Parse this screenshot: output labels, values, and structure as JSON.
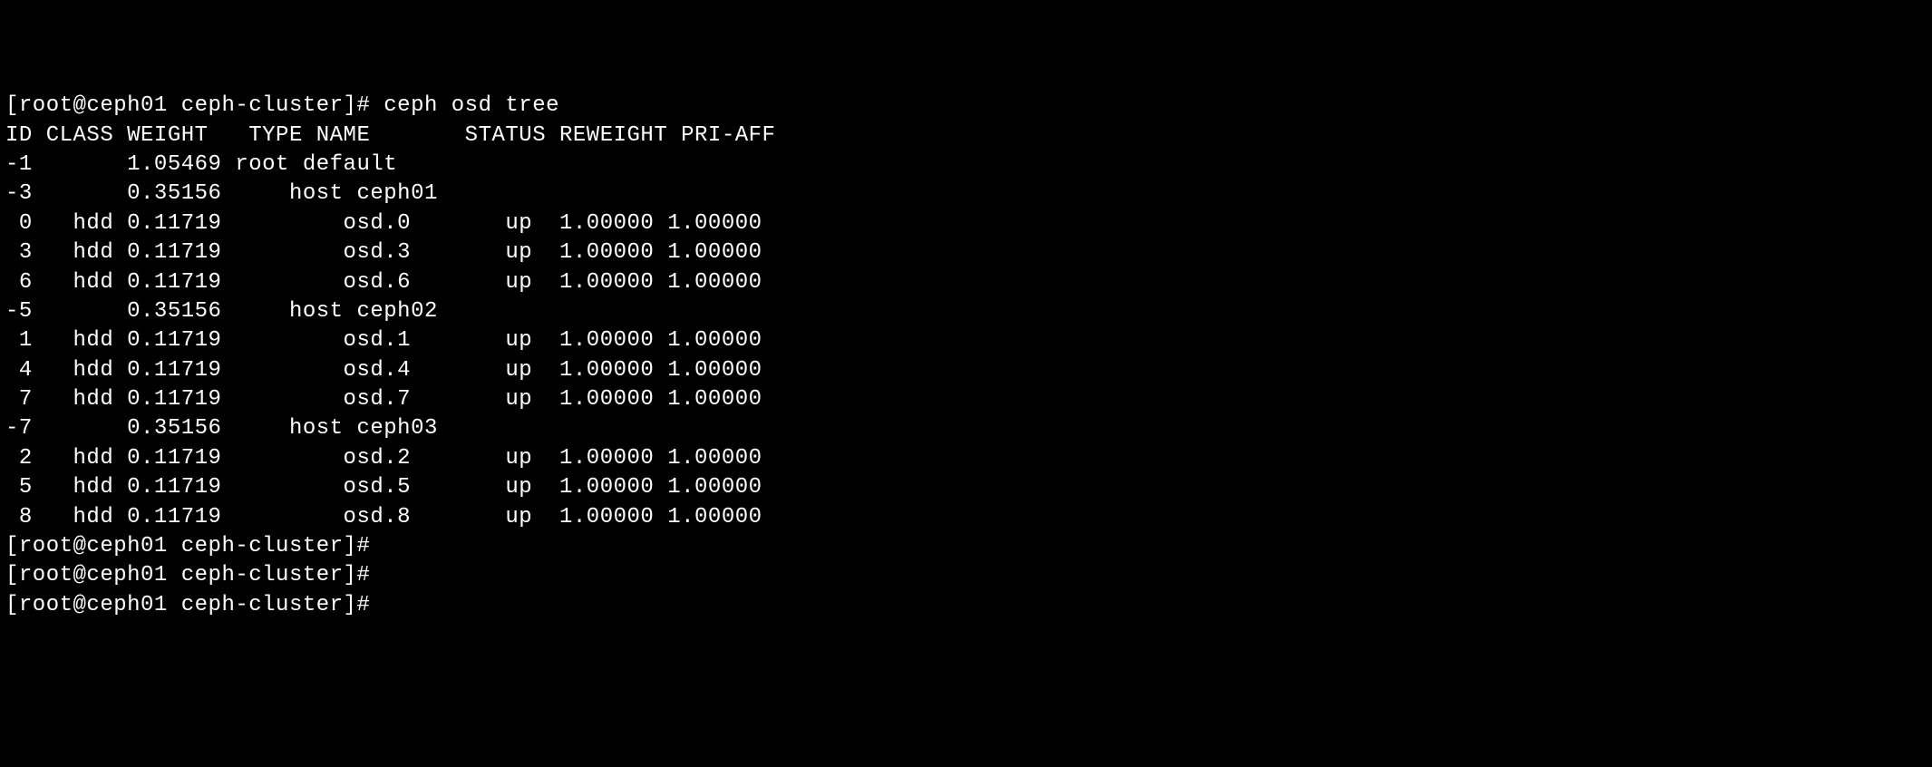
{
  "prompt": {
    "user": "root",
    "host": "ceph01",
    "dir": "ceph-cluster",
    "symbol": "#"
  },
  "command": "ceph osd tree",
  "header": {
    "id": "ID",
    "class": "CLASS",
    "weight": "WEIGHT",
    "type_name": "TYPE NAME",
    "status": "STATUS",
    "reweight": "REWEIGHT",
    "pri_aff": "PRI-AFF"
  },
  "rows": [
    {
      "id": "-1",
      "class": "",
      "weight": "1.05469",
      "type_name": "root default",
      "status": "",
      "reweight": "",
      "pri_aff": ""
    },
    {
      "id": "-3",
      "class": "",
      "weight": "0.35156",
      "type_name": "    host ceph01",
      "status": "",
      "reweight": "",
      "pri_aff": ""
    },
    {
      "id": " 0",
      "class": "hdd",
      "weight": "0.11719",
      "type_name": "        osd.0",
      "status": "up",
      "reweight": "1.00000",
      "pri_aff": "1.00000"
    },
    {
      "id": " 3",
      "class": "hdd",
      "weight": "0.11719",
      "type_name": "        osd.3",
      "status": "up",
      "reweight": "1.00000",
      "pri_aff": "1.00000"
    },
    {
      "id": " 6",
      "class": "hdd",
      "weight": "0.11719",
      "type_name": "        osd.6",
      "status": "up",
      "reweight": "1.00000",
      "pri_aff": "1.00000"
    },
    {
      "id": "-5",
      "class": "",
      "weight": "0.35156",
      "type_name": "    host ceph02",
      "status": "",
      "reweight": "",
      "pri_aff": ""
    },
    {
      "id": " 1",
      "class": "hdd",
      "weight": "0.11719",
      "type_name": "        osd.1",
      "status": "up",
      "reweight": "1.00000",
      "pri_aff": "1.00000"
    },
    {
      "id": " 4",
      "class": "hdd",
      "weight": "0.11719",
      "type_name": "        osd.4",
      "status": "up",
      "reweight": "1.00000",
      "pri_aff": "1.00000"
    },
    {
      "id": " 7",
      "class": "hdd",
      "weight": "0.11719",
      "type_name": "        osd.7",
      "status": "up",
      "reweight": "1.00000",
      "pri_aff": "1.00000"
    },
    {
      "id": "-7",
      "class": "",
      "weight": "0.35156",
      "type_name": "    host ceph03",
      "status": "",
      "reweight": "",
      "pri_aff": ""
    },
    {
      "id": " 2",
      "class": "hdd",
      "weight": "0.11719",
      "type_name": "        osd.2",
      "status": "up",
      "reweight": "1.00000",
      "pri_aff": "1.00000"
    },
    {
      "id": " 5",
      "class": "hdd",
      "weight": "0.11719",
      "type_name": "        osd.5",
      "status": "up",
      "reweight": "1.00000",
      "pri_aff": "1.00000"
    },
    {
      "id": " 8",
      "class": "hdd",
      "weight": "0.11719",
      "type_name": "        osd.8",
      "status": "up",
      "reweight": "1.00000",
      "pri_aff": "1.00000"
    }
  ],
  "trailing_prompts": 3
}
